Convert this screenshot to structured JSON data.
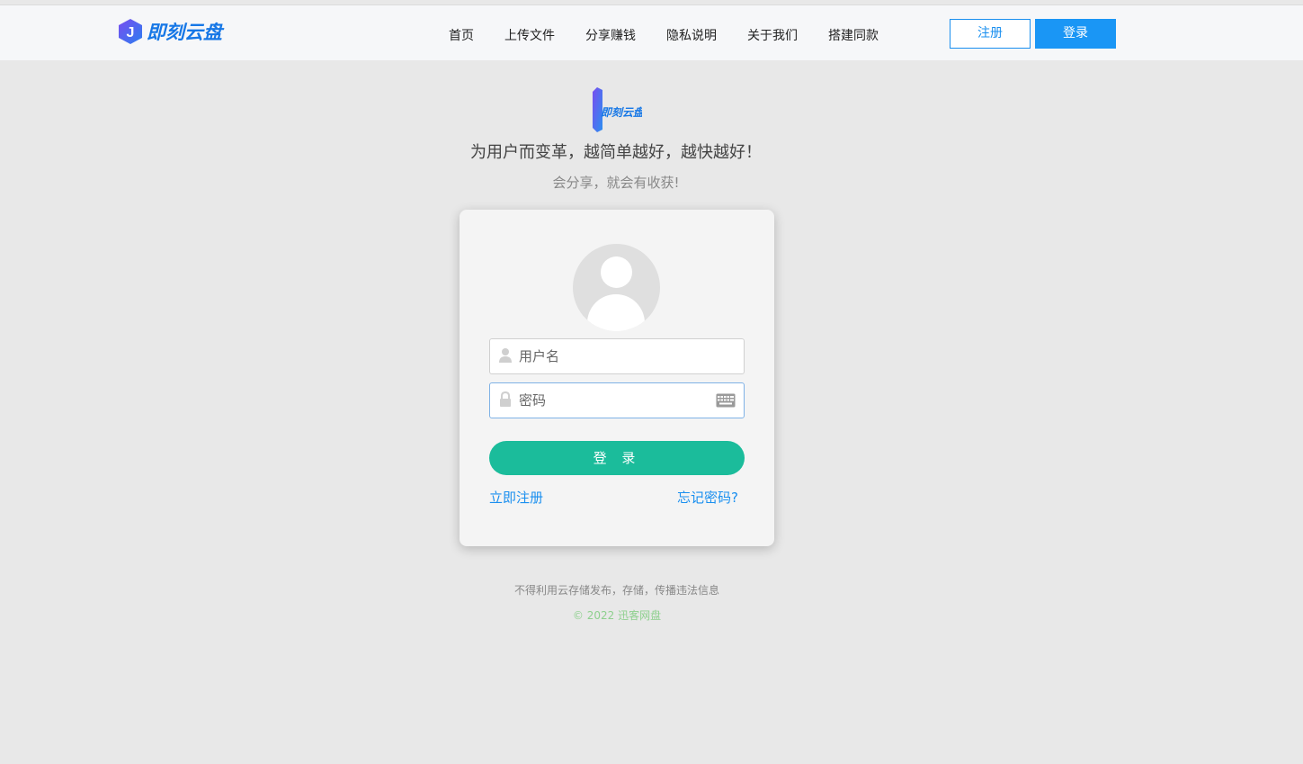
{
  "header": {
    "brand_name": "即刻云盘",
    "nav": [
      {
        "label": "首页"
      },
      {
        "label": "上传文件"
      },
      {
        "label": "分享赚钱"
      },
      {
        "label": "隐私说明"
      },
      {
        "label": "关于我们"
      },
      {
        "label": "搭建同款"
      }
    ],
    "register_label": "注册",
    "login_label": "登录"
  },
  "hero": {
    "logo_text": "即刻云盘",
    "slogan": "为用户而变革，越简单越好，越快越好！",
    "subslogan": "会分享，就会有收获!"
  },
  "login": {
    "username_placeholder": "用户名",
    "password_placeholder": "密码",
    "submit_label": "登 录",
    "register_link": "立即注册",
    "forgot_link": "忘记密码?"
  },
  "footer": {
    "notice": "不得利用云存储发布，存储，传播违法信息",
    "copyright": "© 2022 迅客网盘"
  },
  "colors": {
    "accent": "#1a96f5",
    "submit": "#1bbc9b",
    "brand": "#1677e6",
    "page_bg": "#e8e8e8"
  },
  "icons": {
    "brand_logo": "brand-logo-icon",
    "user": "user-icon",
    "lock": "lock-icon",
    "keyboard": "keyboard-icon"
  }
}
